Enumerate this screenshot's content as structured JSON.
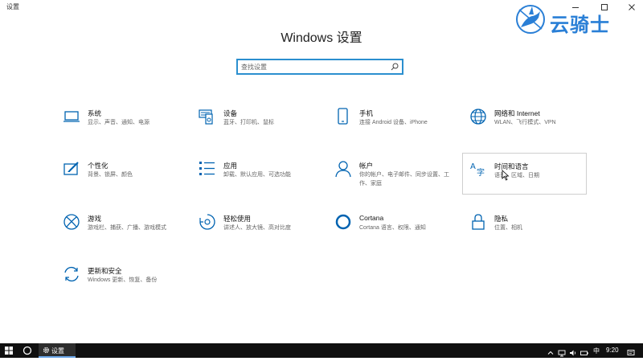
{
  "window": {
    "title": "设置"
  },
  "watermark": {
    "text": "云骑士"
  },
  "main": {
    "title": "Windows 设置"
  },
  "search": {
    "placeholder": "查找设置"
  },
  "tiles": [
    {
      "name": "系统",
      "desc": "显示、声音、通知、电源",
      "icon": "laptop-icon"
    },
    {
      "name": "设备",
      "desc": "蓝牙、打印机、鼠标",
      "icon": "devices-icon"
    },
    {
      "name": "手机",
      "desc": "连接 Android 设备、iPhone",
      "icon": "phone-icon"
    },
    {
      "name": "网络和 Internet",
      "desc": "WLAN、飞行模式、VPN",
      "icon": "globe-icon"
    },
    {
      "name": "个性化",
      "desc": "背景、锁屏、颜色",
      "icon": "personalization-icon"
    },
    {
      "name": "应用",
      "desc": "卸载、默认应用、可选功能",
      "icon": "apps-list-icon"
    },
    {
      "name": "帐户",
      "desc": "你的帐户、电子邮件、同步设置、工作、家庭",
      "icon": "person-icon"
    },
    {
      "name": "时间和语言",
      "desc": "语音、区域、日期",
      "icon": "time-language-icon"
    },
    {
      "name": "游戏",
      "desc": "游戏栏、捕获、广播、游戏模式",
      "icon": "xbox-icon"
    },
    {
      "name": "轻松使用",
      "desc": "讲述人、放大镜、高对比度",
      "icon": "ease-of-access-icon"
    },
    {
      "name": "Cortana",
      "desc": "Cortana 语言、权限、通知",
      "icon": "cortana-icon"
    },
    {
      "name": "隐私",
      "desc": "位置、相机",
      "icon": "lock-icon"
    },
    {
      "name": "更新和安全",
      "desc": "Windows 更新、恢复、备份",
      "icon": "update-icon"
    }
  ],
  "taskbar": {
    "app_label": "设置",
    "ime": "中",
    "time": "9:20"
  },
  "colors": {
    "accent": "#0063b1",
    "search_border": "#2b8fcf",
    "taskbar": "#101010"
  }
}
